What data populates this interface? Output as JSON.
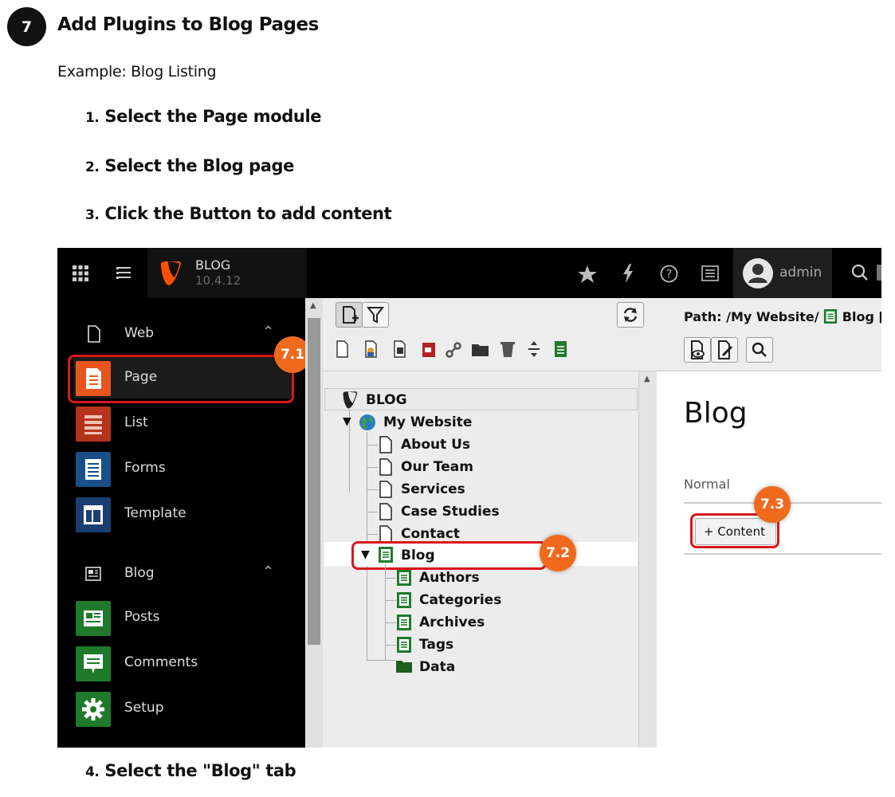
{
  "step": {
    "number": "7",
    "title": "Add Plugins to Blog Pages",
    "subtitle": "Example: Blog Listing"
  },
  "instructions": [
    {
      "num": "1.",
      "text": "Select the Page module"
    },
    {
      "num": "2.",
      "text": "Select the Blog page"
    },
    {
      "num": "3.",
      "text": "Click the Button to add content"
    },
    {
      "num": "4.",
      "text": "Select the \"Blog\" tab"
    }
  ],
  "app": {
    "name": "BLOG",
    "version": "10.4.12",
    "brand_color": "#ff4f00"
  },
  "user": {
    "name": "admin"
  },
  "topbar_icons": [
    "apps-grid-icon",
    "list-toggle-icon",
    "star-icon",
    "bolt-icon",
    "help-icon",
    "list-icon",
    "search-icon"
  ],
  "sidebar": {
    "groups": [
      {
        "label": "Web",
        "icon": "file-icon",
        "modules": [
          {
            "label": "Page",
            "color": "#e8561d",
            "active": true
          },
          {
            "label": "List",
            "color": "#b5331c"
          },
          {
            "label": "Forms",
            "color": "#1b4f8a"
          },
          {
            "label": "Template",
            "color": "#1a3e70"
          }
        ]
      },
      {
        "label": "Blog",
        "icon": "newspaper-icon",
        "modules": [
          {
            "label": "Posts",
            "color": "#1f7a2c"
          },
          {
            "label": "Comments",
            "color": "#1f7a2c"
          },
          {
            "label": "Setup",
            "color": "#1f7a2c"
          }
        ]
      }
    ]
  },
  "tree": {
    "root": "BLOG",
    "site": "My Website",
    "pages": [
      "About Us",
      "Our Team",
      "Services",
      "Case Studies",
      "Contact"
    ],
    "blog": "Blog",
    "blog_children": [
      "Authors",
      "Categories",
      "Archives",
      "Tags",
      "Data"
    ]
  },
  "content": {
    "path": "Path: /My Website/",
    "path_page": "Blog [",
    "heading": "Blog",
    "column": "Normal",
    "add_button": "+ Content"
  },
  "markers": {
    "page_module": "7.1",
    "blog_page": "7.2",
    "content_button": "7.3"
  },
  "highlight_color": "#d9181c",
  "marker_color": "#f06a1d"
}
